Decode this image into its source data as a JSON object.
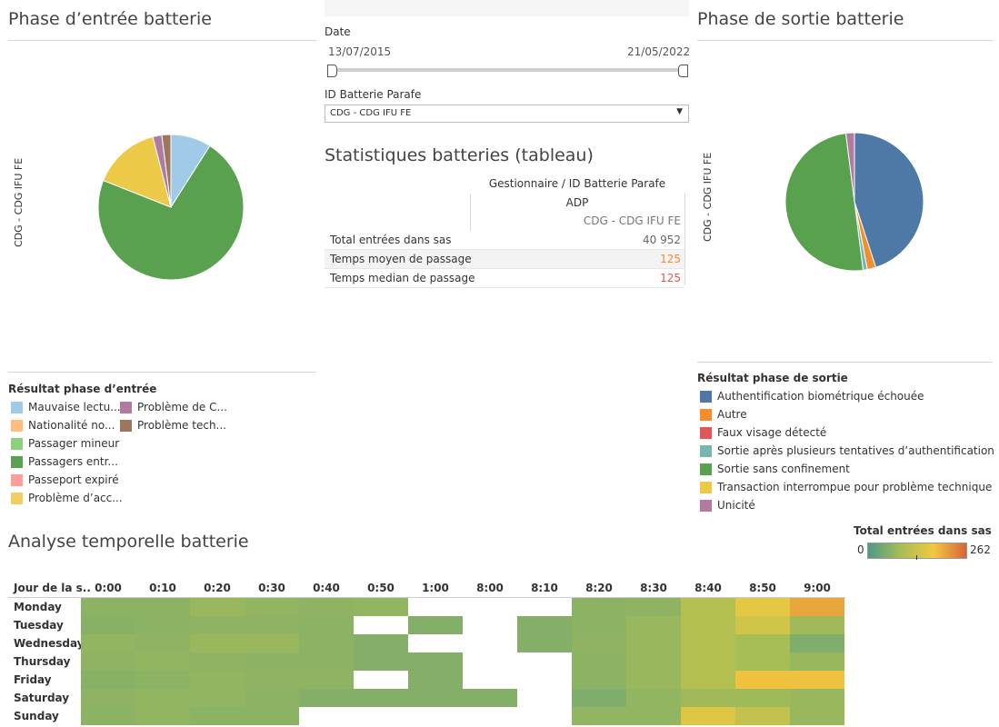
{
  "entry": {
    "title": "Phase d’entrée batterie",
    "axis_label": "CDG - CDG IFU FE",
    "legend_title": "Résultat phase d’entrée",
    "legend_col1": [
      {
        "label": "Mauvaise lectu...",
        "color": "#a0cbe8"
      },
      {
        "label": "Nationalité no...",
        "color": "#ffbe7d"
      },
      {
        "label": "Passager mineur",
        "color": "#8cd17d"
      },
      {
        "label": "Passagers entr...",
        "color": "#59a14f"
      },
      {
        "label": "Passeport expiré",
        "color": "#ff9d9a"
      },
      {
        "label": "Problème d’acc...",
        "color": "#f1ce63"
      }
    ],
    "legend_col2": [
      {
        "label": "Problème de C...",
        "color": "#b07aa1"
      },
      {
        "label": "Problème tech...",
        "color": "#9d7660"
      }
    ]
  },
  "filters": {
    "date_label": "Date",
    "date_start": "13/07/2015",
    "date_end": "21/05/2022",
    "id_label": "ID Batterie Parafe",
    "id_value": "CDG - CDG IFU FE"
  },
  "stats": {
    "title": "Statistiques batteries (tableau)",
    "header_line1": "Gestionnaire  /  ID Batterie Parafe",
    "header_line2": "ADP",
    "header_line3": "CDG - CDG IFU FE",
    "rows": [
      {
        "label": "Total entrées dans sas",
        "value": "40 952",
        "color": "#666666"
      },
      {
        "label": "Temps moyen de passage ..",
        "value": "125",
        "color": "#f28e2b"
      },
      {
        "label": "Temps median de passage..",
        "value": "125",
        "color": "#e15759"
      }
    ]
  },
  "exit": {
    "title": "Phase de sortie batterie",
    "axis_label": "CDG - CDG IFU FE",
    "legend_title": "Résultat phase de sortie",
    "legend": [
      {
        "label": "Authentification biométrique échouée",
        "color": "#4e79a7"
      },
      {
        "label": "Autre",
        "color": "#f28e2b"
      },
      {
        "label": "Faux visage détecté",
        "color": "#e15759"
      },
      {
        "label": "Sortie après plusieurs tentatives d’authentification",
        "color": "#76b7b2"
      },
      {
        "label": "Sortie sans confinement",
        "color": "#59a14f"
      },
      {
        "label": "Transaction interrompue pour problème technique",
        "color": "#edc948"
      },
      {
        "label": "Unicité",
        "color": "#b07aa1"
      }
    ]
  },
  "heatmap": {
    "title": "Analyse temporelle batterie",
    "legend_title": "Total entrées dans sas",
    "legend_min": "0",
    "legend_max": "262",
    "row_header": "Jour de la s..",
    "columns": [
      "0:00",
      "0:10",
      "0:20",
      "0:30",
      "0:40",
      "0:50",
      "1:00",
      "8:00",
      "8:10",
      "8:20",
      "8:30",
      "8:40",
      "8:50",
      "9:00"
    ],
    "rows": [
      "Monday",
      "Tuesday",
      "Wednesday",
      "Thursday",
      "Friday",
      "Saturday",
      "Sunday"
    ]
  },
  "chart_data": [
    {
      "type": "pie",
      "title": "Phase d’entrée batterie",
      "categories": [
        "Mauvaise lectu...",
        "Passagers entr...",
        "Problème d’acc...",
        "Problème de C...",
        "Problème tech..."
      ],
      "values": [
        9,
        72,
        15,
        2,
        2
      ],
      "colors": [
        "#a0cbe8",
        "#59a14f",
        "#edc948",
        "#b07aa1",
        "#9d7660"
      ]
    },
    {
      "type": "pie",
      "title": "Phase de sortie batterie",
      "categories": [
        "Authentification biométrique échouée",
        "Autre",
        "Sortie après plusieurs tentatives d’authentification",
        "Sortie sans confinement",
        "Unicité"
      ],
      "values": [
        45,
        2,
        1,
        50,
        2
      ],
      "colors": [
        "#4e79a7",
        "#f28e2b",
        "#76b7b2",
        "#59a14f",
        "#b07aa1"
      ]
    },
    {
      "type": "heatmap",
      "title": "Analyse temporelle batterie",
      "x": [
        "0:00",
        "0:10",
        "0:20",
        "0:30",
        "0:40",
        "0:50",
        "1:00",
        "8:00",
        "8:10",
        "8:20",
        "8:30",
        "8:40",
        "8:50",
        "9:00"
      ],
      "y": [
        "Monday",
        "Tuesday",
        "Wednesday",
        "Thursday",
        "Friday",
        "Saturday",
        "Sunday"
      ],
      "range": [
        0,
        262
      ],
      "values": [
        [
          90,
          90,
          110,
          100,
          95,
          100,
          null,
          null,
          null,
          90,
          95,
          140,
          175,
          210
        ],
        [
          85,
          90,
          95,
          95,
          90,
          null,
          80,
          null,
          80,
          90,
          110,
          140,
          160,
          120
        ],
        [
          100,
          95,
          110,
          110,
          90,
          80,
          null,
          null,
          80,
          95,
          110,
          140,
          130,
          70
        ],
        [
          95,
          100,
          95,
          90,
          90,
          80,
          80,
          null,
          null,
          90,
          110,
          140,
          130,
          110
        ],
        [
          85,
          90,
          100,
          95,
          95,
          null,
          80,
          null,
          null,
          90,
          110,
          140,
          190,
          190
        ],
        [
          95,
          100,
          100,
          90,
          80,
          80,
          80,
          80,
          null,
          70,
          100,
          120,
          120,
          110
        ],
        [
          90,
          100,
          90,
          90,
          null,
          null,
          null,
          null,
          null,
          100,
          100,
          170,
          150,
          110
        ]
      ]
    }
  ]
}
